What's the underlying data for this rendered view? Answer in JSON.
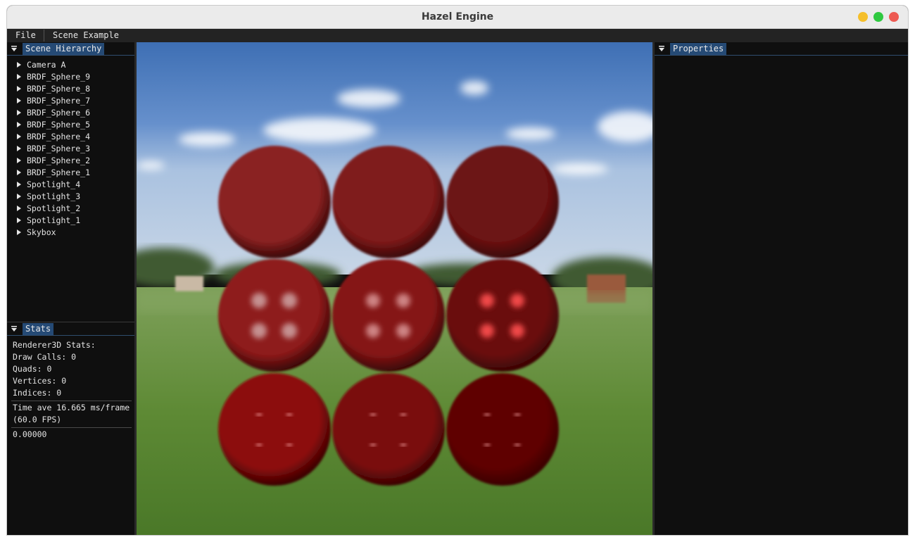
{
  "window": {
    "title": "Hazel Engine"
  },
  "menu": {
    "file": "File",
    "scene_example": "Scene Example"
  },
  "scene_hierarchy": {
    "tab": "Scene Hierarchy",
    "items": [
      "Camera A",
      "BRDF_Sphere_9",
      "BRDF_Sphere_8",
      "BRDF_Sphere_7",
      "BRDF_Sphere_6",
      "BRDF_Sphere_5",
      "BRDF_Sphere_4",
      "BRDF_Sphere_3",
      "BRDF_Sphere_2",
      "BRDF_Sphere_1",
      "Spotlight_4",
      "Spotlight_3",
      "Spotlight_2",
      "Spotlight_1",
      "Skybox"
    ]
  },
  "stats": {
    "tab": "Stats",
    "title": "Renderer3D Stats:",
    "draw_calls": "Draw Calls: 0",
    "quads": "Quads: 0",
    "vertices": "Vertices: 0",
    "indices": "Indices: 0",
    "time_line1": "Time ave 16.665 ms/frame",
    "time_line2": "(60.0 FPS)",
    "value": "0.00000"
  },
  "properties": {
    "tab": "Properties"
  },
  "colors": {
    "accent_tab": "#254a75",
    "close": "#ed5a52",
    "maximize": "#2fc940",
    "minimize": "#f5bf2b",
    "sphere_red": "#8b1414"
  },
  "viewport": {
    "spheres": [
      {
        "row": 1,
        "col": 1,
        "tone": "#8a2222",
        "specular": "none"
      },
      {
        "row": 1,
        "col": 2,
        "tone": "#7f1a1a",
        "specular": "none"
      },
      {
        "row": 1,
        "col": 3,
        "tone": "#6c1212",
        "specular": "none"
      },
      {
        "row": 2,
        "col": 1,
        "tone": "#8e1a1a",
        "specular": "broad"
      },
      {
        "row": 2,
        "col": 2,
        "tone": "#851515",
        "specular": "medium"
      },
      {
        "row": 2,
        "col": 3,
        "tone": "#6a0c0c",
        "specular": "tight"
      },
      {
        "row": 3,
        "col": 1,
        "tone": "#8c0808",
        "specular": "pinpoint"
      },
      {
        "row": 3,
        "col": 2,
        "tone": "#7a0909",
        "specular": "pinpoint"
      },
      {
        "row": 3,
        "col": 3,
        "tone": "#5e0606",
        "specular": "pinpoint"
      }
    ]
  }
}
